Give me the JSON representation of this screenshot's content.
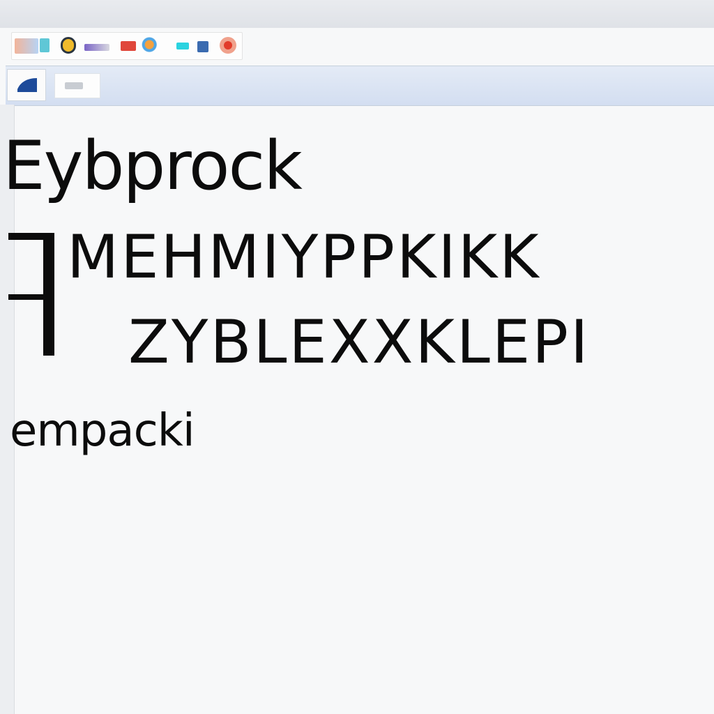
{
  "toolbar": {
    "icons": [
      "app-icon",
      "tool-icon",
      "emoji-icon",
      "palette-icon",
      "image-icon",
      "color-wheel-icon",
      "highlight-icon",
      "shape-icon",
      "record-icon"
    ]
  },
  "nav": {
    "back_icon": "back-icon",
    "tab_icon": "page-icon"
  },
  "content": {
    "heading": "Eybprock",
    "line_1": "MEHMIYPPKIKK",
    "line_2": "ZYBLEXXKLEPI",
    "word": "empacki"
  },
  "colors": {
    "text": "#0c0c0c",
    "nav_bar": "#d3def1",
    "back_icon": "#1e4b9a"
  }
}
